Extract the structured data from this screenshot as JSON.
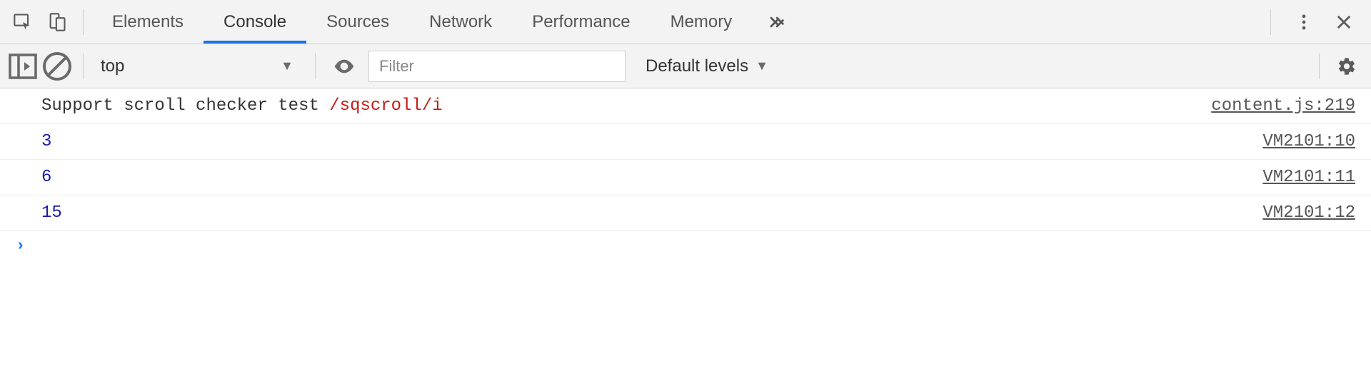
{
  "tabs": {
    "elements": "Elements",
    "console": "Console",
    "sources": "Sources",
    "network": "Network",
    "performance": "Performance",
    "memory": "Memory"
  },
  "console_toolbar": {
    "context": "top",
    "filter_placeholder": "Filter",
    "levels": "Default levels"
  },
  "logs": [
    {
      "text": "Support scroll checker test ",
      "regex": "/sqscroll/i",
      "source": "content.js:219"
    },
    {
      "number": "3",
      "source": "VM2101:10"
    },
    {
      "number": "6",
      "source": "VM2101:11"
    },
    {
      "number": "15",
      "source": "VM2101:12"
    }
  ],
  "prompt": {
    "chevron": "›"
  }
}
